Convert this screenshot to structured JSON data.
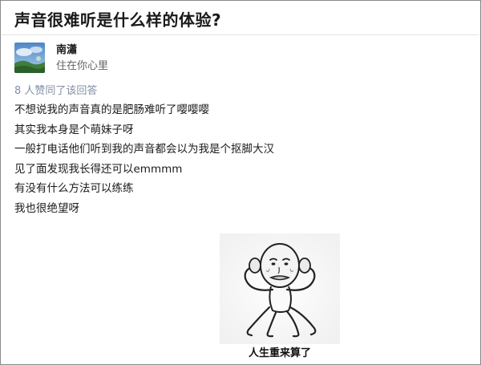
{
  "question": {
    "title": "声音很难听是什么样的体验?"
  },
  "author": {
    "name": "南瀟",
    "bio": "住在你心里"
  },
  "answer": {
    "vote_text": "8 人赞同了该回答",
    "lines": [
      "不想说我的声音真的是肥肠难听了嘤嘤嘤",
      "其实我本身是个萌妹子呀",
      "一般打电话他们听到我的声音都会以为我是个抠脚大汉",
      "见了面发现我长得还可以emmmm",
      "有没有什么方法可以练练",
      "我也很绝望呀"
    ]
  },
  "meme": {
    "caption": "人生重来算了"
  }
}
